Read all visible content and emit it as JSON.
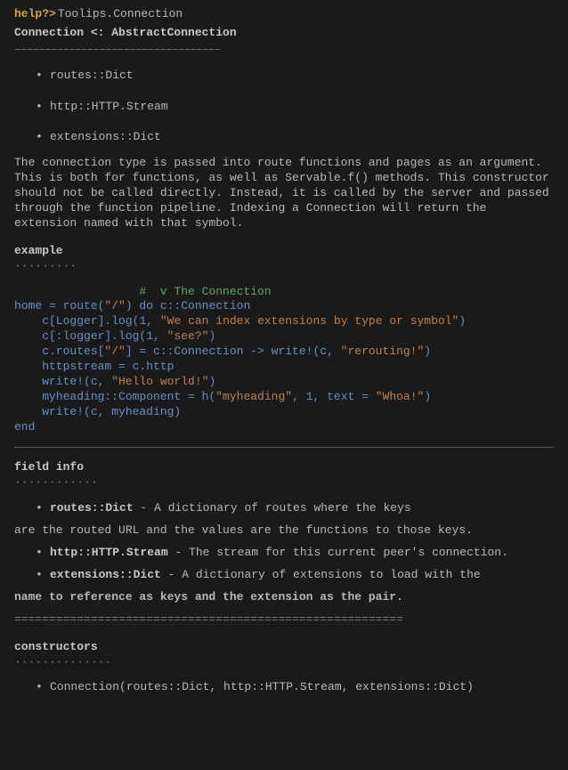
{
  "prompt": {
    "label": "help?>",
    "input": " Toolips.Connection"
  },
  "title": "Connection <: AbstractConnection",
  "title_underline": "––––––––––––––––––––––––––––––––––",
  "fields": [
    "routes::Dict",
    "http::HTTP.Stream",
    "extensions::Dict"
  ],
  "description": "The connection type is passed into route functions and pages as an argument. This is both for functions, as well as Servable.f() methods. This constructor should not be called directly. Instead, it is called by the server and passed through the function pipeline. Indexing a Connection will return the extension named with that symbol.",
  "example": {
    "header": "example",
    "dots": "·········",
    "code": {
      "l1_pre": "                  ",
      "l1_comment": "#  v The Connection",
      "l2_pre": "home = route(",
      "l2_str": "\"/\"",
      "l2_post": ") do c::Connection",
      "l3_pre": "    c[Logger].log(",
      "l3_num": "1",
      "l3_mid": ", ",
      "l3_str": "\"We can index extensions by type or symbol\"",
      "l3_post": ")",
      "l4_pre": "    c[:logger].log(",
      "l4_num": "1",
      "l4_mid": ", ",
      "l4_str": "\"see?\"",
      "l4_post": ")",
      "l5_pre": "    c.routes[",
      "l5_str1": "\"/\"",
      "l5_mid": "] = c::Connection -> write!(c, ",
      "l5_str2": "\"rerouting!\"",
      "l5_post": ")",
      "l6": "    httpstream = c.http",
      "l7_pre": "    write!(c, ",
      "l7_str": "\"Hello world!\"",
      "l7_post": ")",
      "l8_pre": "    myheading::Component = h(",
      "l8_str1": "\"myheading\"",
      "l8_mid1": ", ",
      "l8_num": "1",
      "l8_mid2": ", text = ",
      "l8_str2": "\"Whoa!\"",
      "l8_post": ")",
      "l9": "    write!(c, myheading)",
      "l10": "end"
    }
  },
  "fieldinfo": {
    "header": "field info",
    "dots": "············",
    "items": [
      {
        "name": "routes::Dict",
        "desc": " - A dictionary of routes where the keys"
      },
      {
        "name": "http::HTTP.Stream",
        "desc": " - The stream for this current peer's connection."
      },
      {
        "name": "extensions::Dict",
        "desc": " - A dictionary of extensions to load with the"
      }
    ],
    "cont1": "are the routed URL and the values are the functions to those keys.",
    "cont2": "name to reference as keys and the extension as the pair.",
    "separator": "========================================================"
  },
  "constructors": {
    "header": "constructors",
    "dots": "··············",
    "items": [
      "Connection(routes::Dict, http::HTTP.Stream, extensions::Dict)"
    ]
  }
}
